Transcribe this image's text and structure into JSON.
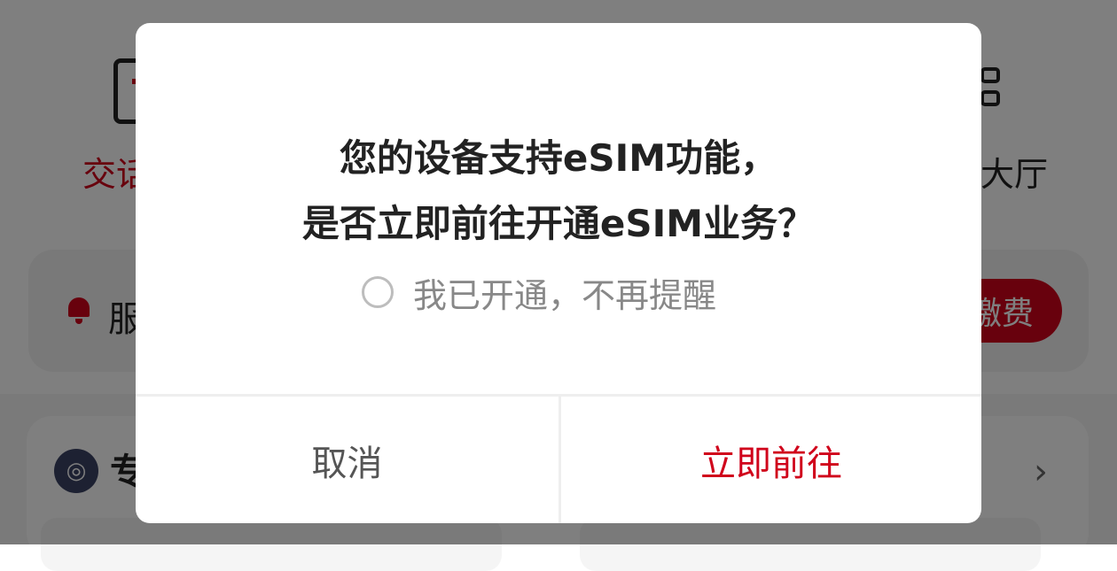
{
  "background": {
    "nav_left_label": "交话",
    "nav_right_label": "大厅",
    "notice_text": "服",
    "pay_button_label": "缴费",
    "service_logo_glyph": "◎",
    "service_title": "专",
    "chevron_glyph": "›"
  },
  "dialog": {
    "title_line1": "您的设备支持eSIM功能，",
    "title_line2": "是否立即前往开通eSIM业务？",
    "dont_remind_label": "我已开通，不再提醒",
    "dont_remind_checked": false,
    "cancel_label": "取消",
    "confirm_label": "立即前往"
  },
  "colors": {
    "accent_red": "#d0021b",
    "overlay": "rgba(0,0,0,0.5)"
  }
}
